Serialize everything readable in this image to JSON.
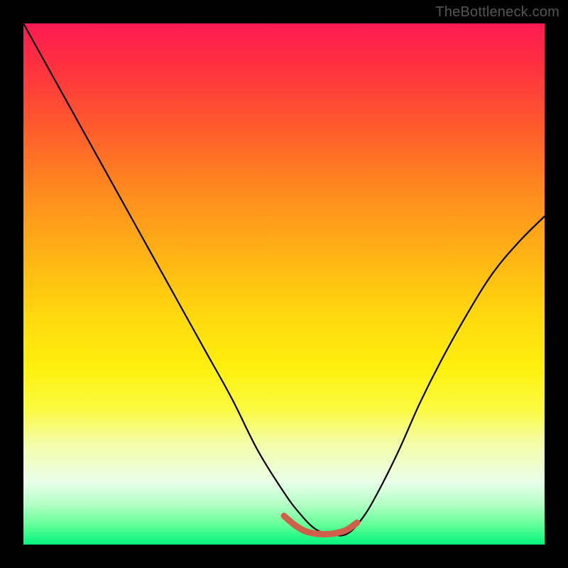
{
  "watermark": "TheBottleneck.com",
  "chart_data": {
    "type": "line",
    "title": "",
    "xlabel": "",
    "ylabel": "",
    "xlim": [
      0,
      100
    ],
    "ylim": [
      0,
      100
    ],
    "grid": false,
    "legend": false,
    "annotations": [],
    "description": "V-shaped bottleneck curve over a vertical red-to-green heat gradient. The curve descends steeply from top-left, flattens briefly near the bottom around x≈55–63, then rises toward the upper right. A short red segment highlights the flat bottom region.",
    "series": [
      {
        "name": "curve",
        "type": "line",
        "color": "#000000",
        "x": [
          0,
          5,
          10,
          15,
          20,
          25,
          30,
          35,
          40,
          45,
          50,
          53,
          56,
          59,
          62,
          65,
          68,
          72,
          76,
          80,
          85,
          90,
          95,
          100
        ],
        "y": [
          100,
          91,
          82,
          73,
          64,
          55,
          46,
          37,
          28,
          18,
          10,
          6,
          3,
          2,
          2,
          5,
          10,
          18,
          27,
          35,
          44,
          52,
          58,
          63
        ]
      },
      {
        "name": "highlight",
        "type": "line",
        "color": "#d0634f",
        "x": [
          50,
          52,
          54,
          56,
          58,
          60,
          62,
          64
        ],
        "y": [
          5.5,
          3.8,
          2.6,
          2.1,
          2.0,
          2.2,
          2.8,
          4.2
        ]
      }
    ]
  }
}
